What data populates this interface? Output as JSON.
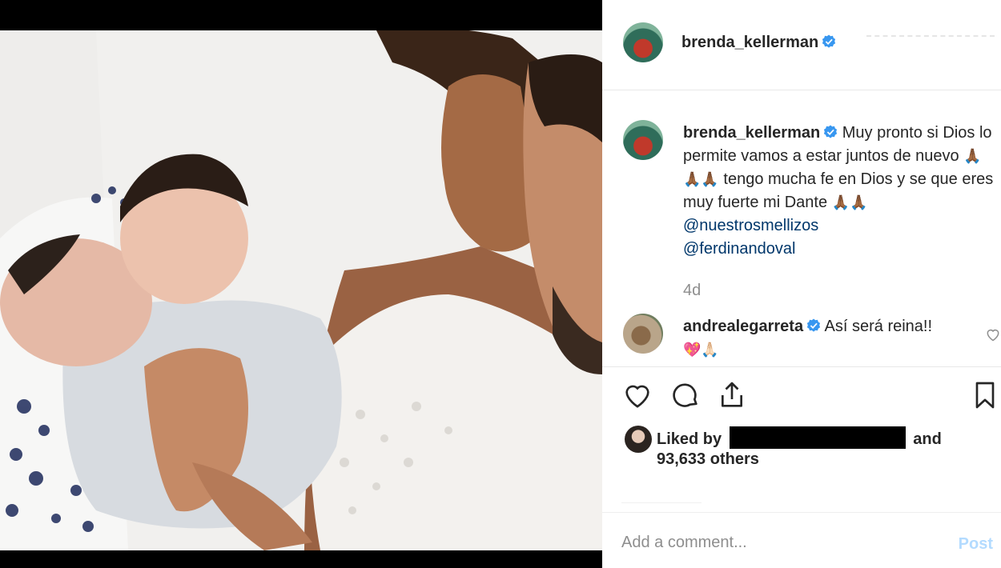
{
  "post": {
    "author": "brenda_kellerman",
    "verified": true,
    "image_alt": "Couple holding newborn twins"
  },
  "caption": {
    "username": "brenda_kellerman",
    "text_part1": "Muy pronto si Dios lo permite vamos a estar juntos de nuevo",
    "emoji1": "🙏🏾🙏🏾🙏🏾",
    "text_part2": "tengo mucha fe en Dios y se que eres muy fuerte mi Dante",
    "emoji2": "🙏🏾🙏🏾",
    "mention1": "@nuestrosmellizos",
    "mention2": "@ferdinandoval",
    "time": "4d"
  },
  "comment": {
    "username": "andrealegarreta",
    "text": "Así será reina!!",
    "emoji": "💖🙏🏻"
  },
  "likes": {
    "prefix": "Liked by",
    "suffix": "and",
    "count": "93,633 others"
  },
  "comment_box": {
    "placeholder": "Add a comment...",
    "post_label": "Post"
  },
  "icons": [
    "verified-badge-icon",
    "heart-icon",
    "comment-icon",
    "share-icon",
    "bookmark-icon"
  ],
  "colors": {
    "verified": "#3897f0",
    "link": "#00376b",
    "post_disabled": "#b3dbff",
    "muted": "#8e8e8e"
  }
}
